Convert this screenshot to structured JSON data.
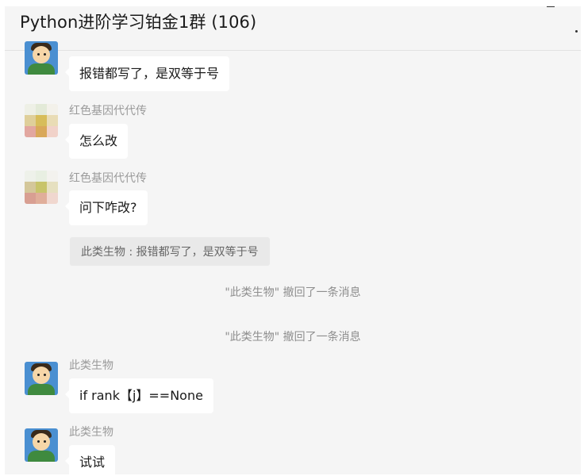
{
  "chat": {
    "title": "Python进阶学习铂金1群 (106)"
  },
  "messages": [
    {
      "sender": "",
      "text": "报错都写了，是双等于号"
    },
    {
      "sender": "红色基因代代传",
      "text": "怎么改"
    },
    {
      "sender": "红色基因代代传",
      "text": "问下咋改?",
      "quote": "此类生物 : 报错都写了，是双等于号"
    },
    {
      "system": "\"此类生物\" 撤回了一条消息"
    },
    {
      "system": "\"此类生物\" 撤回了一条消息"
    },
    {
      "sender": "此类生物",
      "text": "if rank【j】==None"
    },
    {
      "sender": "此类生物",
      "text": "试试"
    }
  ],
  "colors": {
    "background": "#f5f5f5",
    "bubble": "#ffffff",
    "quote_bg": "#e9e9e9",
    "system_text": "#8e8e8e"
  }
}
